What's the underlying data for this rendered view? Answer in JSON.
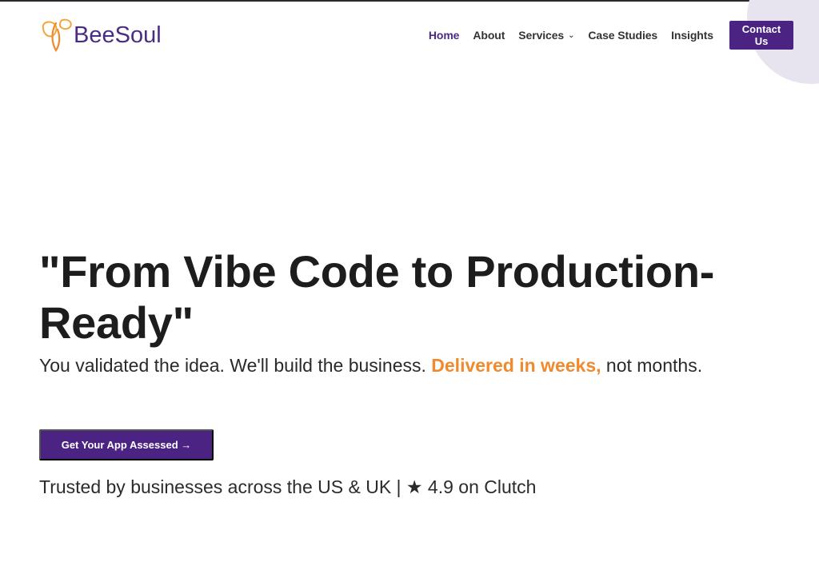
{
  "brand": {
    "name": "BeeSoul",
    "accent": "#4b2483",
    "highlight": "#f08a2c"
  },
  "nav": {
    "home": "Home",
    "about": "About",
    "services": "Services",
    "case_studies": "Case Studies",
    "insights": "Insights",
    "contact": "Contact Us",
    "services_icon": "chevron-down-icon"
  },
  "hero": {
    "title": "\"From Vibe Code to Production-Ready\"",
    "subtitle_lead": "You validated the idea. We'll build the business. ",
    "subtitle_accent": "Delivered in weeks,",
    "subtitle_tail": " not months.",
    "cta": "Get Your App Assessed →",
    "trust": "Trusted by businesses across the US & UK | ★ 4.9 on Clutch"
  }
}
